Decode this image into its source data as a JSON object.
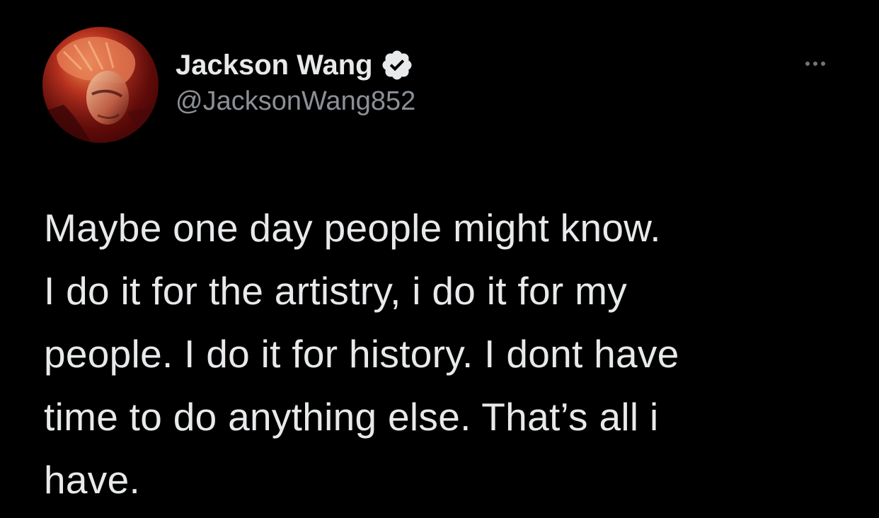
{
  "tweet": {
    "author": {
      "display_name": "Jackson Wang",
      "handle": "@JacksonWang852",
      "verified": true,
      "avatar_icon": "profile-photo"
    },
    "more_icon": "ellipsis-icon",
    "text": "Maybe one day people might know.\nI do it for the artistry, i do it for my\npeople. I do it for history. I dont have\ntime to do anything else. That’s all i\nhave."
  },
  "colors": {
    "background": "#000000",
    "primary_text": "#e7e9ea",
    "secondary_text": "#8b9096",
    "verified_badge": "#e7e9ea"
  }
}
